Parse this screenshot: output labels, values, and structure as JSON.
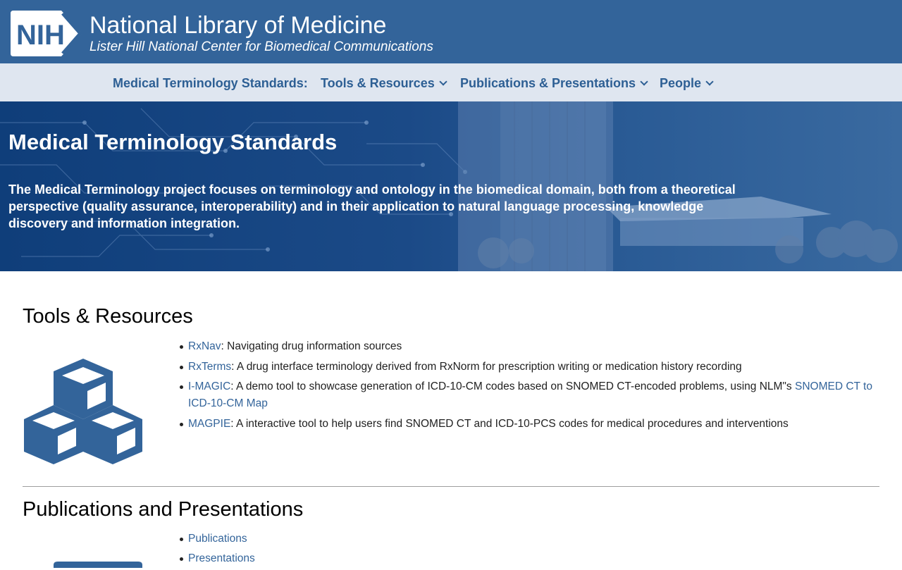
{
  "header": {
    "logo_text": "NIH",
    "title": "National Library of Medicine",
    "subtitle": "Lister Hill National Center for Biomedical Communications"
  },
  "nav": {
    "items": [
      {
        "label": "Medical Terminology Standards:",
        "dropdown": false
      },
      {
        "label": "Tools & Resources",
        "dropdown": true
      },
      {
        "label": "Publications & Presentations",
        "dropdown": true
      },
      {
        "label": "People",
        "dropdown": true
      }
    ]
  },
  "hero": {
    "title": "Medical Terminology Standards",
    "description": "The Medical Terminology project focuses on terminology and ontology in the biomedical domain, both from a theoretical perspective (quality assurance, interoperability) and in their application to natural language processing, knowledge discovery and information integration."
  },
  "tools": {
    "heading": "Tools & Resources",
    "icon": "cubes-icon",
    "items": [
      {
        "link": "RxNav",
        "text": ": Navigating drug information sources"
      },
      {
        "link": "RxTerms",
        "text": ": A drug interface terminology derived from RxNorm for prescription writing or medication history recording"
      },
      {
        "link": "I-MAGIC",
        "text": ": A demo tool to showcase generation of ICD-10-CM codes based on SNOMED CT-encoded problems, using NLM\"s ",
        "link2": "SNOMED CT to ICD-10-CM Map"
      },
      {
        "link": "MAGPIE",
        "text": ": A interactive tool to help users find SNOMED CT and ICD-10-PCS codes for medical procedures and interventions"
      }
    ]
  },
  "publications": {
    "heading": "Publications and Presentations",
    "items": [
      {
        "link": "Publications"
      },
      {
        "link": "Presentations"
      }
    ]
  },
  "colors": {
    "header_bg": "#33649a",
    "nav_bg": "#dfe6f0",
    "link": "#33649a",
    "hero_bg": "#1b4a87"
  }
}
